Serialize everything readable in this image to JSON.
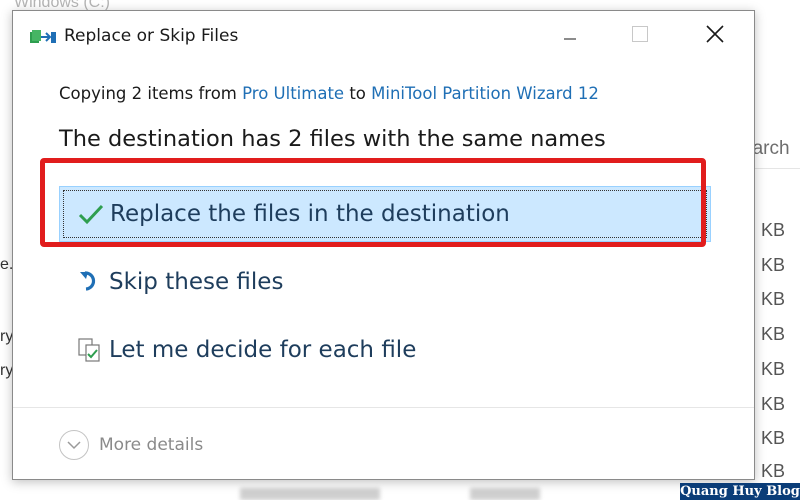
{
  "background": {
    "window_title": "Windows (C:)",
    "search_hint": "earch",
    "size_unit": "KB",
    "left_fragments": [
      "e.",
      "ry",
      "ry"
    ]
  },
  "dialog": {
    "title": "Replace or Skip Files",
    "copying_prefix": "Copying 2 items from ",
    "source": "Pro Ultimate",
    "to_word": " to ",
    "destination": "MiniTool Partition Wizard 12",
    "headline": "The destination has 2 files with the same names",
    "options": {
      "replace": "Replace the files in the destination",
      "skip": "Skip these files",
      "decide": "Let me decide for each file"
    },
    "more_details": "More details"
  },
  "icons": {
    "title": "file-transfer-icon",
    "minimize": "minimize-icon",
    "maximize": "maximize-icon",
    "close": "close-icon",
    "replace": "checkmark-icon",
    "skip": "skip-arrow-icon",
    "decide": "compare-files-icon",
    "more": "chevron-down-icon"
  },
  "colors": {
    "link": "#1f6fb5",
    "option_text": "#1e3d5c",
    "selected_bg": "#cce8ff",
    "highlight": "#e11d1d",
    "check_green": "#2e9e4f"
  },
  "watermark": "Quang Huy Blog"
}
